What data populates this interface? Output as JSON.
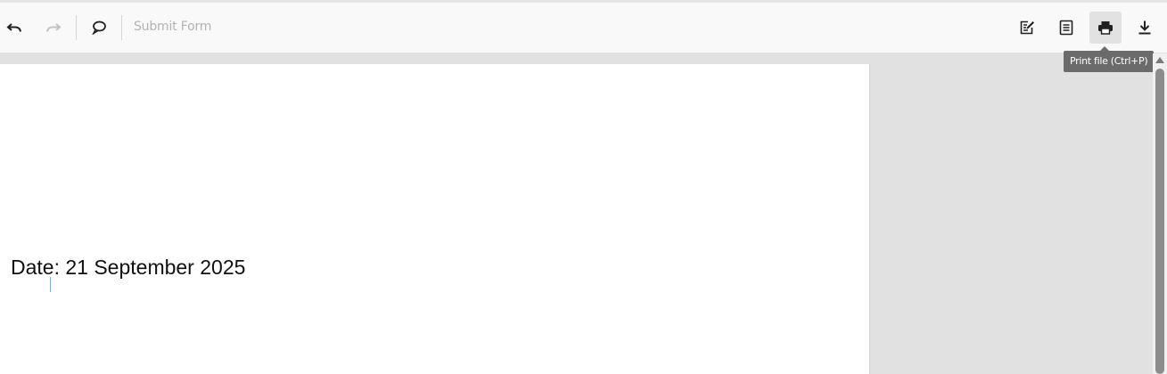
{
  "toolbar": {
    "undo_icon": "undo-icon",
    "redo_icon": "redo-icon",
    "comment_icon": "comment-icon",
    "submit_label": "Submit Form",
    "edit_icon": "edit-icon",
    "view_icon": "document-view-icon",
    "print_icon": "print-icon",
    "download_icon": "download-icon"
  },
  "tooltip": {
    "text": "Print file (Ctrl+P)"
  },
  "document": {
    "text": "Date: 21 September 2025"
  },
  "colors": {
    "toolbar_bg": "#f9f9f9",
    "canvas_bg": "#e1e1e1",
    "tooltip_bg": "#6b6b6b",
    "active_button_bg": "#e2e2e2",
    "disabled_text": "#b3b3b3"
  }
}
